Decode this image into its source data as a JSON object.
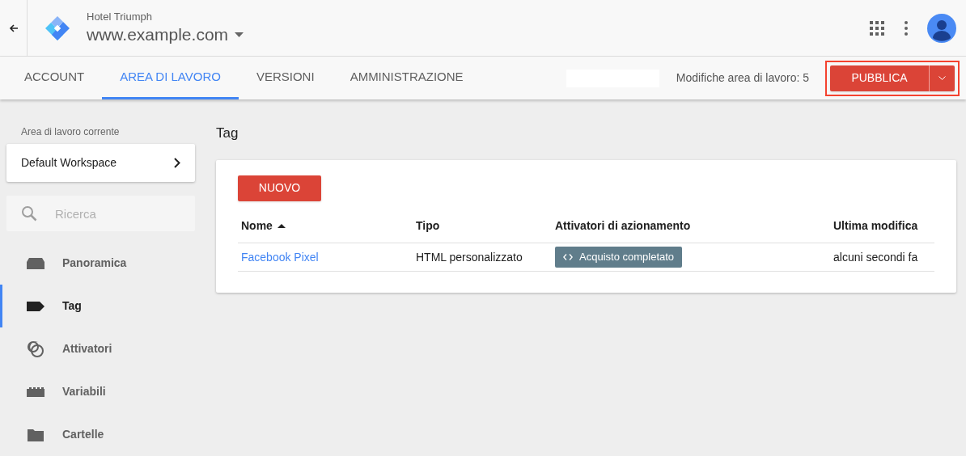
{
  "header": {
    "account": "Hotel Triumph",
    "container": "www.example.com"
  },
  "tabs": [
    {
      "label": "ACCOUNT",
      "selected": false
    },
    {
      "label": "AREA DI LAVORO",
      "selected": true
    },
    {
      "label": "VERSIONI",
      "selected": false
    },
    {
      "label": "AMMINISTRAZIONE",
      "selected": false
    }
  ],
  "workspace_changes": "Modifiche area di lavoro: 5",
  "publish": {
    "label": "PUBBLICA",
    "highlighted": true
  },
  "sidebar": {
    "workspace_label": "Area di lavoro corrente",
    "workspace": "Default Workspace",
    "search": {
      "placeholder": "Ricerca"
    },
    "items": [
      {
        "label": "Panoramica",
        "selected": false
      },
      {
        "label": "Tag",
        "selected": true
      },
      {
        "label": "Attivatori",
        "selected": false
      },
      {
        "label": "Variabili",
        "selected": false
      },
      {
        "label": "Cartelle",
        "selected": false
      }
    ]
  },
  "page_title": "Tag",
  "new_button": "NUOVO",
  "table": {
    "columns": [
      "Nome",
      "Tipo",
      "Attivatori di azionamento",
      "Ultima modifica"
    ],
    "rows": [
      {
        "name": "Facebook Pixel",
        "type": "HTML personalizzato",
        "trigger": "Acquisto completato",
        "modified": "alcuni secondi fa"
      }
    ]
  }
}
